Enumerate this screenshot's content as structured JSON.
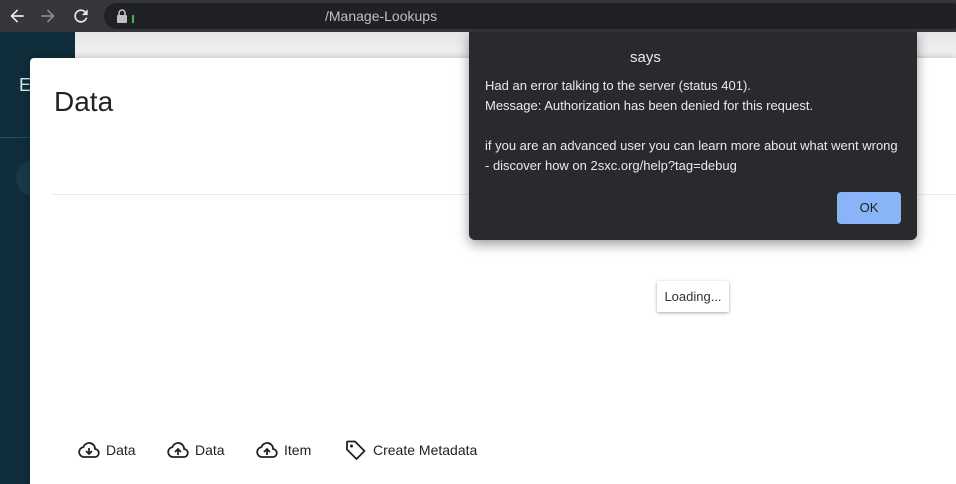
{
  "browser": {
    "url_path": "/Manage-Lookups"
  },
  "sidebar": {
    "letter": "E"
  },
  "dialog": {
    "title": "Data",
    "loading_text": "Loading...",
    "toolbar": [
      {
        "label": "Data",
        "icon": "cloud-download-icon"
      },
      {
        "label": "Data",
        "icon": "cloud-upload-icon"
      },
      {
        "label": "Item",
        "icon": "cloud-upload-icon"
      },
      {
        "label": "Create Metadata",
        "icon": "tag-icon"
      }
    ]
  },
  "alert": {
    "title": "says",
    "lines": [
      "Had an error talking to the server (status 401).",
      "Message: Authorization has been denied for this request.",
      "",
      "if you are an advanced user you can learn more about what went wrong",
      "- discover how on 2sxc.org/help?tag=debug"
    ],
    "ok_label": "OK",
    "button_color": "#8ab4f8",
    "background_color": "#292a2d"
  }
}
